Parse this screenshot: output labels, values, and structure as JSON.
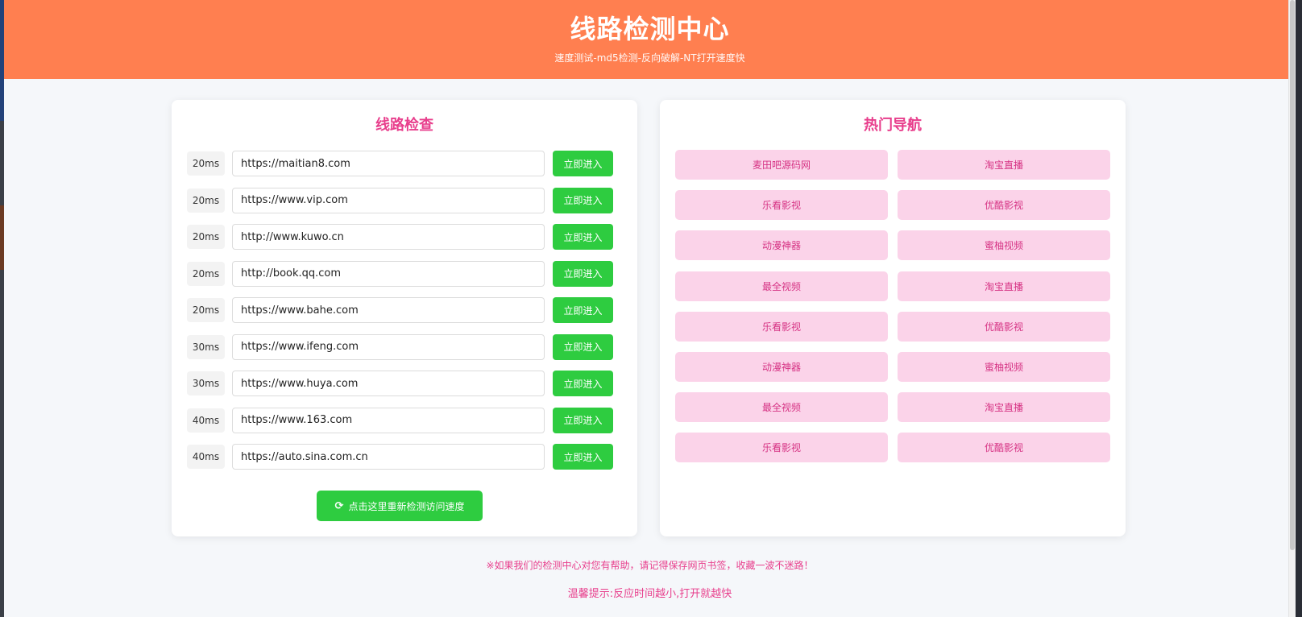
{
  "header": {
    "title": "线路检测中心",
    "subtitle": "速度测试-md5检测-反向破解-NT打开速度快"
  },
  "line_check": {
    "title": "线路检查",
    "rows": [
      {
        "latency": "20ms",
        "url": "https://maitian8.com",
        "button": "立即进入"
      },
      {
        "latency": "20ms",
        "url": "https://www.vip.com",
        "button": "立即进入"
      },
      {
        "latency": "20ms",
        "url": "http://www.kuwo.cn",
        "button": "立即进入"
      },
      {
        "latency": "20ms",
        "url": "http://book.qq.com",
        "button": "立即进入"
      },
      {
        "latency": "20ms",
        "url": "https://www.bahe.com",
        "button": "立即进入"
      },
      {
        "latency": "30ms",
        "url": "https://www.ifeng.com",
        "button": "立即进入"
      },
      {
        "latency": "30ms",
        "url": "https://www.huya.com",
        "button": "立即进入"
      },
      {
        "latency": "40ms",
        "url": "https://www.163.com",
        "button": "立即进入"
      },
      {
        "latency": "40ms",
        "url": "https://auto.sina.com.cn",
        "button": "立即进入"
      }
    ],
    "recheck_label": "点击这里重新检测访问速度",
    "recheck_icon": "refresh-icon"
  },
  "hot_nav": {
    "title": "热门导航",
    "items": [
      "麦田吧源码网",
      "淘宝直播",
      "乐看影视",
      "优酷影视",
      "动漫神器",
      "蜜柚视频",
      "最全视频",
      "淘宝直播",
      "乐看影视",
      "优酷影视",
      "动漫神器",
      "蜜柚视频",
      "最全视频",
      "淘宝直播",
      "乐看影视",
      "优酷影视"
    ]
  },
  "footer": {
    "note": "※如果我们的检测中心对您有帮助，请记得保存网页书签，收藏一波不迷路！",
    "tip": "温馨提示:反应时间越小,打开就越快"
  },
  "colors": {
    "header_bg": "#ff7f50",
    "accent_pink": "#e83e8c",
    "button_green": "#2ecc40",
    "nav_bg": "#fbd3e9"
  }
}
